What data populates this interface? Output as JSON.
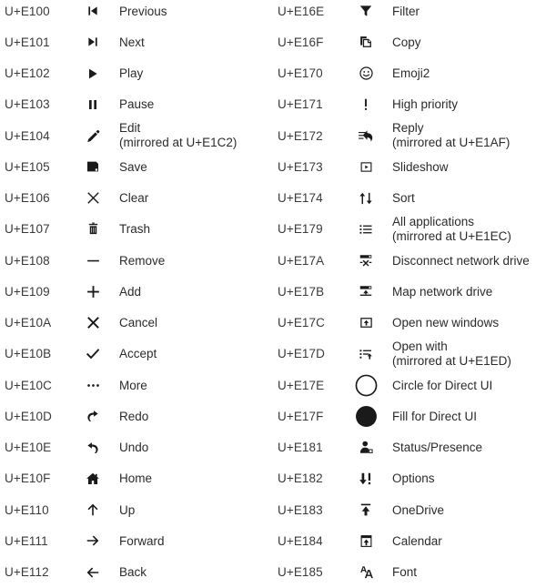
{
  "page": {
    "kind": "segoe-mdl2-icon-reference-table",
    "background_color": "#ffffff",
    "code_text_color": "#3a3a3a",
    "label_text_color": "#2b2b2b",
    "icon_color": "#1a1a1a",
    "column_count": 2,
    "row_count": 19
  },
  "columns": {
    "left": {
      "rows": [
        {
          "code": "U+E100",
          "icon": "previous-icon",
          "label": "Previous",
          "sublabel": ""
        },
        {
          "code": "U+E101",
          "icon": "next-icon",
          "label": "Next",
          "sublabel": ""
        },
        {
          "code": "U+E102",
          "icon": "play-icon",
          "label": "Play",
          "sublabel": ""
        },
        {
          "code": "U+E103",
          "icon": "pause-icon",
          "label": "Pause",
          "sublabel": ""
        },
        {
          "code": "U+E104",
          "icon": "edit-pencil-icon",
          "label": "Edit",
          "sublabel": "(mirrored at U+E1C2)"
        },
        {
          "code": "U+E105",
          "icon": "save-floppy-icon",
          "label": "Save",
          "sublabel": ""
        },
        {
          "code": "U+E106",
          "icon": "clear-x-icon",
          "label": "Clear",
          "sublabel": ""
        },
        {
          "code": "U+E107",
          "icon": "trash-icon",
          "label": "Trash",
          "sublabel": ""
        },
        {
          "code": "U+E108",
          "icon": "remove-minus-icon",
          "label": "Remove",
          "sublabel": ""
        },
        {
          "code": "U+E109",
          "icon": "add-plus-icon",
          "label": "Add",
          "sublabel": ""
        },
        {
          "code": "U+E10A",
          "icon": "cancel-x-icon",
          "label": "Cancel",
          "sublabel": ""
        },
        {
          "code": "U+E10B",
          "icon": "accept-check-icon",
          "label": "Accept",
          "sublabel": ""
        },
        {
          "code": "U+E10C",
          "icon": "more-ellipsis-icon",
          "label": "More",
          "sublabel": ""
        },
        {
          "code": "U+E10D",
          "icon": "redo-icon",
          "label": "Redo",
          "sublabel": ""
        },
        {
          "code": "U+E10E",
          "icon": "undo-icon",
          "label": "Undo",
          "sublabel": ""
        },
        {
          "code": "U+E10F",
          "icon": "home-icon",
          "label": "Home",
          "sublabel": ""
        },
        {
          "code": "U+E110",
          "icon": "up-arrow-icon",
          "label": "Up",
          "sublabel": ""
        },
        {
          "code": "U+E111",
          "icon": "forward-arrow-icon",
          "label": "Forward",
          "sublabel": ""
        },
        {
          "code": "U+E112",
          "icon": "back-arrow-icon",
          "label": "Back",
          "sublabel": ""
        }
      ]
    },
    "right": {
      "rows": [
        {
          "code": "U+E16E",
          "icon": "filter-funnel-icon",
          "label": "Filter",
          "sublabel": ""
        },
        {
          "code": "U+E16F",
          "icon": "copy-icon",
          "label": "Copy",
          "sublabel": ""
        },
        {
          "code": "U+E170",
          "icon": "emoji2-smiley-icon",
          "label": "Emoji2",
          "sublabel": ""
        },
        {
          "code": "U+E171",
          "icon": "high-priority-exclamation-icon",
          "label": "High priority",
          "sublabel": ""
        },
        {
          "code": "U+E172",
          "icon": "reply-icon",
          "label": "Reply",
          "sublabel": "(mirrored at U+E1AF)"
        },
        {
          "code": "U+E173",
          "icon": "slideshow-icon",
          "label": "Slideshow",
          "sublabel": ""
        },
        {
          "code": "U+E174",
          "icon": "sort-updown-icon",
          "label": "Sort",
          "sublabel": ""
        },
        {
          "code": "U+E179",
          "icon": "all-applications-list-icon",
          "label": "All applications",
          "sublabel": "(mirrored at U+E1EC)"
        },
        {
          "code": "U+E17A",
          "icon": "disconnect-network-drive-icon",
          "label": "Disconnect network drive",
          "sublabel": ""
        },
        {
          "code": "U+E17B",
          "icon": "map-network-drive-icon",
          "label": "Map network drive",
          "sublabel": ""
        },
        {
          "code": "U+E17C",
          "icon": "open-new-windows-icon",
          "label": "Open new windows",
          "sublabel": ""
        },
        {
          "code": "U+E17D",
          "icon": "open-with-icon",
          "label": "Open with",
          "sublabel": "(mirrored at U+E1ED)"
        },
        {
          "code": "U+E17E",
          "icon": "circle-outline-icon",
          "label": "Circle for Direct UI",
          "sublabel": ""
        },
        {
          "code": "U+E17F",
          "icon": "circle-filled-icon",
          "label": "Fill for Direct UI",
          "sublabel": ""
        },
        {
          "code": "U+E181",
          "icon": "status-presence-icon",
          "label": "Status/Presence",
          "sublabel": ""
        },
        {
          "code": "U+E182",
          "icon": "options-down-exclamation-icon",
          "label": "Options",
          "sublabel": ""
        },
        {
          "code": "U+E183",
          "icon": "onedrive-upload-icon",
          "label": "OneDrive",
          "sublabel": ""
        },
        {
          "code": "U+E184",
          "icon": "calendar-upload-icon",
          "label": "Calendar",
          "sublabel": ""
        },
        {
          "code": "U+E185",
          "icon": "font-aa-icon",
          "label": "Font",
          "sublabel": ""
        }
      ]
    }
  }
}
